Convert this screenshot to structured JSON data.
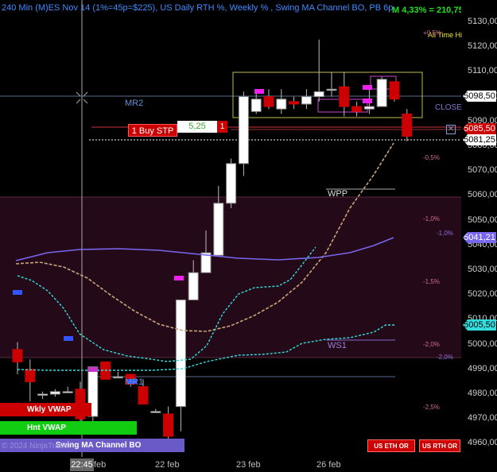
{
  "title": "240 Min (M)ES Nov 14 (1%=45p=$225), US Daily RTH %, Weekly % , Swing MA Channel BO, PB 6p",
  "performance": "M 4,33% = 210,75",
  "y_axis_ticks": [
    "5130,00",
    "5120,00",
    "5110,00",
    "5100,00",
    "5090,00",
    "5080,00",
    "5070,00",
    "5060,00",
    "5050,00",
    "5040,00",
    "5030,00",
    "5020,00",
    "5010,00",
    "5000,00",
    "4990,00",
    "4980,00",
    "4970,00",
    "4960,00"
  ],
  "x_axis": {
    "labels": [
      "22 feb",
      "23 feb",
      "26 feb"
    ],
    "partial_label": "feb",
    "cursor_time": "22:45"
  },
  "price_tags": {
    "crosshair": "5098,50",
    "sell_line": "5085,50",
    "last": "5081,25",
    "ma_upper": "5041,21",
    "ma_lower": "5005,50"
  },
  "levels": {
    "mr2": "MR2",
    "mr1": "MR1",
    "wpp": "WPP",
    "ws1": "WS1",
    "close": "CLOSE",
    "all_time_high": "All Time Hi"
  },
  "pct_labels": {
    "p05": "+0,5%",
    "m05": "-0,5%",
    "m10": "-1,0%",
    "m10b": "-1,0%",
    "m15": "-1,5%",
    "m20": "-2,0%",
    "m20b": "-2,0%",
    "m25": "-2,5%"
  },
  "order": {
    "label": "1 Buy STP",
    "qty": "5,25",
    "count": "1"
  },
  "legend": {
    "wkly_vwap": "Wkly VWAP",
    "hnt_vwap": "Hnt VWAP",
    "swing_ma": "Swing MA Channel BO",
    "copyright": "© 2024 NinjaTrader"
  },
  "buttons": {
    "us_eth": "US ETH OR",
    "us_rth": "US RTH OR"
  },
  "colors": {
    "bull": "#ffffff",
    "bear": "#cc0000",
    "ma_purple": "#7766ee",
    "channel_cyan": "#33dddd",
    "ma_tan": "#c8a478"
  },
  "candles": [
    {
      "o": 4998,
      "h": 5001,
      "l": 4988,
      "c": 4993
    },
    {
      "o": 4990,
      "h": 4994,
      "l": 4977,
      "c": 4985
    },
    {
      "o": 4980,
      "h": 4981,
      "l": 4978,
      "c": 4980
    },
    {
      "o": 4980,
      "h": 4982,
      "l": 4979,
      "c": 4981
    },
    {
      "o": 4981,
      "h": 4983,
      "l": 4982,
      "c": 4981
    },
    {
      "o": 4982,
      "h": 4985,
      "l": 4967,
      "c": 4970
    },
    {
      "o": 4971,
      "h": 4991,
      "l": 4969,
      "c": 4991
    },
    {
      "o": 4993,
      "h": 4992,
      "l": 4988,
      "c": 4986
    },
    {
      "o": 4987,
      "h": 4989,
      "l": 4987,
      "c": 4987
    },
    {
      "o": 4988,
      "h": 4987,
      "l": 4983,
      "c": 4984
    },
    {
      "o": 4983,
      "h": 4986,
      "l": 4976,
      "c": 4976
    },
    {
      "o": 4973,
      "h": 4974,
      "l": 4973,
      "c": 4973
    },
    {
      "o": 4972,
      "h": 4975,
      "l": 4959,
      "c": 4963
    },
    {
      "o": 4975,
      "h": 5018,
      "l": 4965,
      "c": 5018
    },
    {
      "o": 5018,
      "h": 5034,
      "l": 5018,
      "c": 5029
    },
    {
      "o": 5029,
      "h": 5046,
      "l": 5029,
      "c": 5037
    },
    {
      "o": 5036,
      "h": 5064,
      "l": 5036,
      "c": 5057
    },
    {
      "o": 5057,
      "h": 5075,
      "l": 5055,
      "c": 5073
    },
    {
      "o": 5073,
      "h": 5102,
      "l": 5068,
      "c": 5100
    },
    {
      "o": 5094,
      "h": 5103,
      "l": 5093,
      "c": 5099
    },
    {
      "o": 5100,
      "h": 5103,
      "l": 5095,
      "c": 5096
    },
    {
      "o": 5095,
      "h": 5103,
      "l": 5093,
      "c": 5099
    },
    {
      "o": 5098,
      "h": 5100,
      "l": 5095,
      "c": 5097
    },
    {
      "o": 5097,
      "h": 5103,
      "l": 5095,
      "c": 5100
    },
    {
      "o": 5100,
      "h": 5123,
      "l": 5098,
      "c": 5102
    },
    {
      "o": 5103,
      "h": 5110,
      "l": 5100,
      "c": 5103
    },
    {
      "o": 5104,
      "h": 5110,
      "l": 5092,
      "c": 5096
    },
    {
      "o": 5096,
      "h": 5098,
      "l": 5092,
      "c": 5094
    },
    {
      "o": 5095,
      "h": 5103,
      "l": 5093,
      "c": 5096
    },
    {
      "o": 5096,
      "h": 5108,
      "l": 5096,
      "c": 5107
    },
    {
      "o": 5106,
      "h": 5106,
      "l": 5098,
      "c": 5099
    },
    {
      "o": 5093,
      "h": 5095,
      "l": 5082,
      "c": 5084
    }
  ]
}
